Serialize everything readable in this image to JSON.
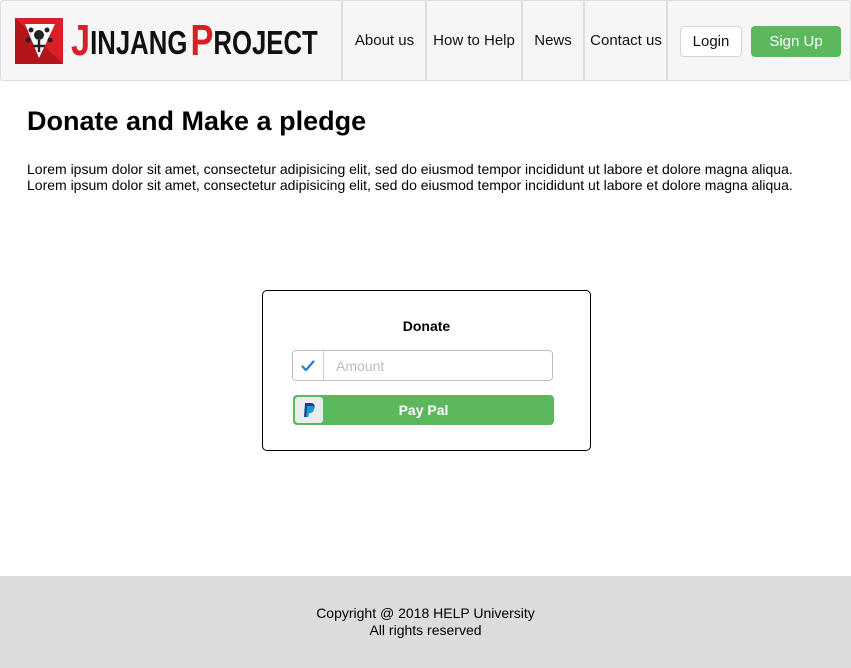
{
  "brand": {
    "first_initial": "J",
    "first_rest": "INJANG",
    "second_initial": "P",
    "second_rest": "ROJECT",
    "logo_icon": "jinjang-logo-icon",
    "accent_color": "#d92027"
  },
  "nav": {
    "items": [
      {
        "label": "About us"
      },
      {
        "label": "How to Help"
      },
      {
        "label": "News"
      },
      {
        "label": "Contact us"
      }
    ],
    "login_label": "Login",
    "signup_label": "Sign Up",
    "signup_color": "#5cb85c"
  },
  "main": {
    "title": "Donate and Make a pledge",
    "intro": "Lorem ipsum dolor sit amet, consectetur adipisicing elit, sed do eiusmod tempor incididunt ut labore et dolore magna aliqua. Lorem ipsum dolor sit amet, consectetur adipisicing elit, sed do eiusmod tempor incididunt ut labore et dolore magna aliqua."
  },
  "donate": {
    "title": "Donate",
    "amount_placeholder": "Amount",
    "amount_value": "",
    "check_icon": "check-icon",
    "paypal_icon": "paypal-icon",
    "paypal_label": "Pay Pal",
    "button_color": "#5cb85c"
  },
  "footer": {
    "copyright": "Copyright @ 2018 HELP University",
    "rights": "All rights reserved"
  }
}
